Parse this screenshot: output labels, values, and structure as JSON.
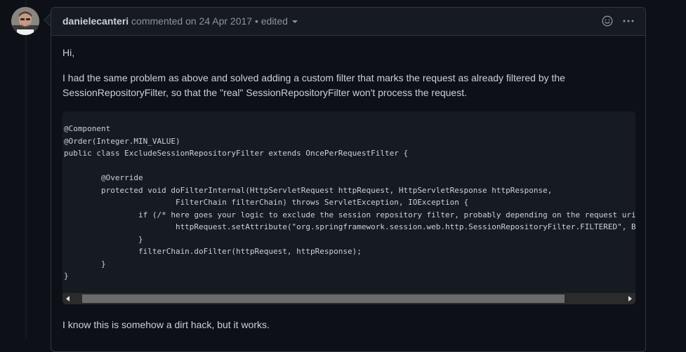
{
  "comment": {
    "author": "danielecanteri",
    "meta": "commented on 24 Apr 2017",
    "separator": "•",
    "edited": "edited",
    "greeting": "Hi,",
    "body": "I had the same problem as above and solved adding a custom filter that marks the request as already filtered by the SessionRepositoryFilter, so that the \"real\" SessionRepositoryFilter won't process the request.",
    "code_lines": [
      "@Component",
      "@Order(Integer.MIN_VALUE)",
      "public class ExcludeSessionRepositoryFilter extends OncePerRequestFilter {",
      "",
      "        @Override",
      "        protected void doFilterInternal(HttpServletRequest httpRequest, HttpServletResponse httpResponse,",
      "                        FilterChain filterChain) throws ServletException, IOException {",
      "                if (/* here goes your logic to exclude the session repository filter, probably depending on the request uri",
      "                        httpRequest.setAttribute(\"org.springframework.session.web.http.SessionRepositoryFilter.FILTERED\", Bo",
      "                }",
      "                filterChain.doFilter(httpRequest, httpResponse);",
      "        }",
      "}"
    ],
    "footer": "I know this is somehow a dirt hack, but it works."
  },
  "icons": {
    "avatar": "user-avatar",
    "emoji": "smiley-icon",
    "more": "kebab-horizontal-icon",
    "edited_dropdown": "triangle-down-icon"
  },
  "colors": {
    "background": "#0d1117",
    "header_bg": "#161b22",
    "border": "#30363d",
    "text": "#c9d1d9",
    "muted": "#8b949e",
    "code_bg": "#161b22"
  }
}
